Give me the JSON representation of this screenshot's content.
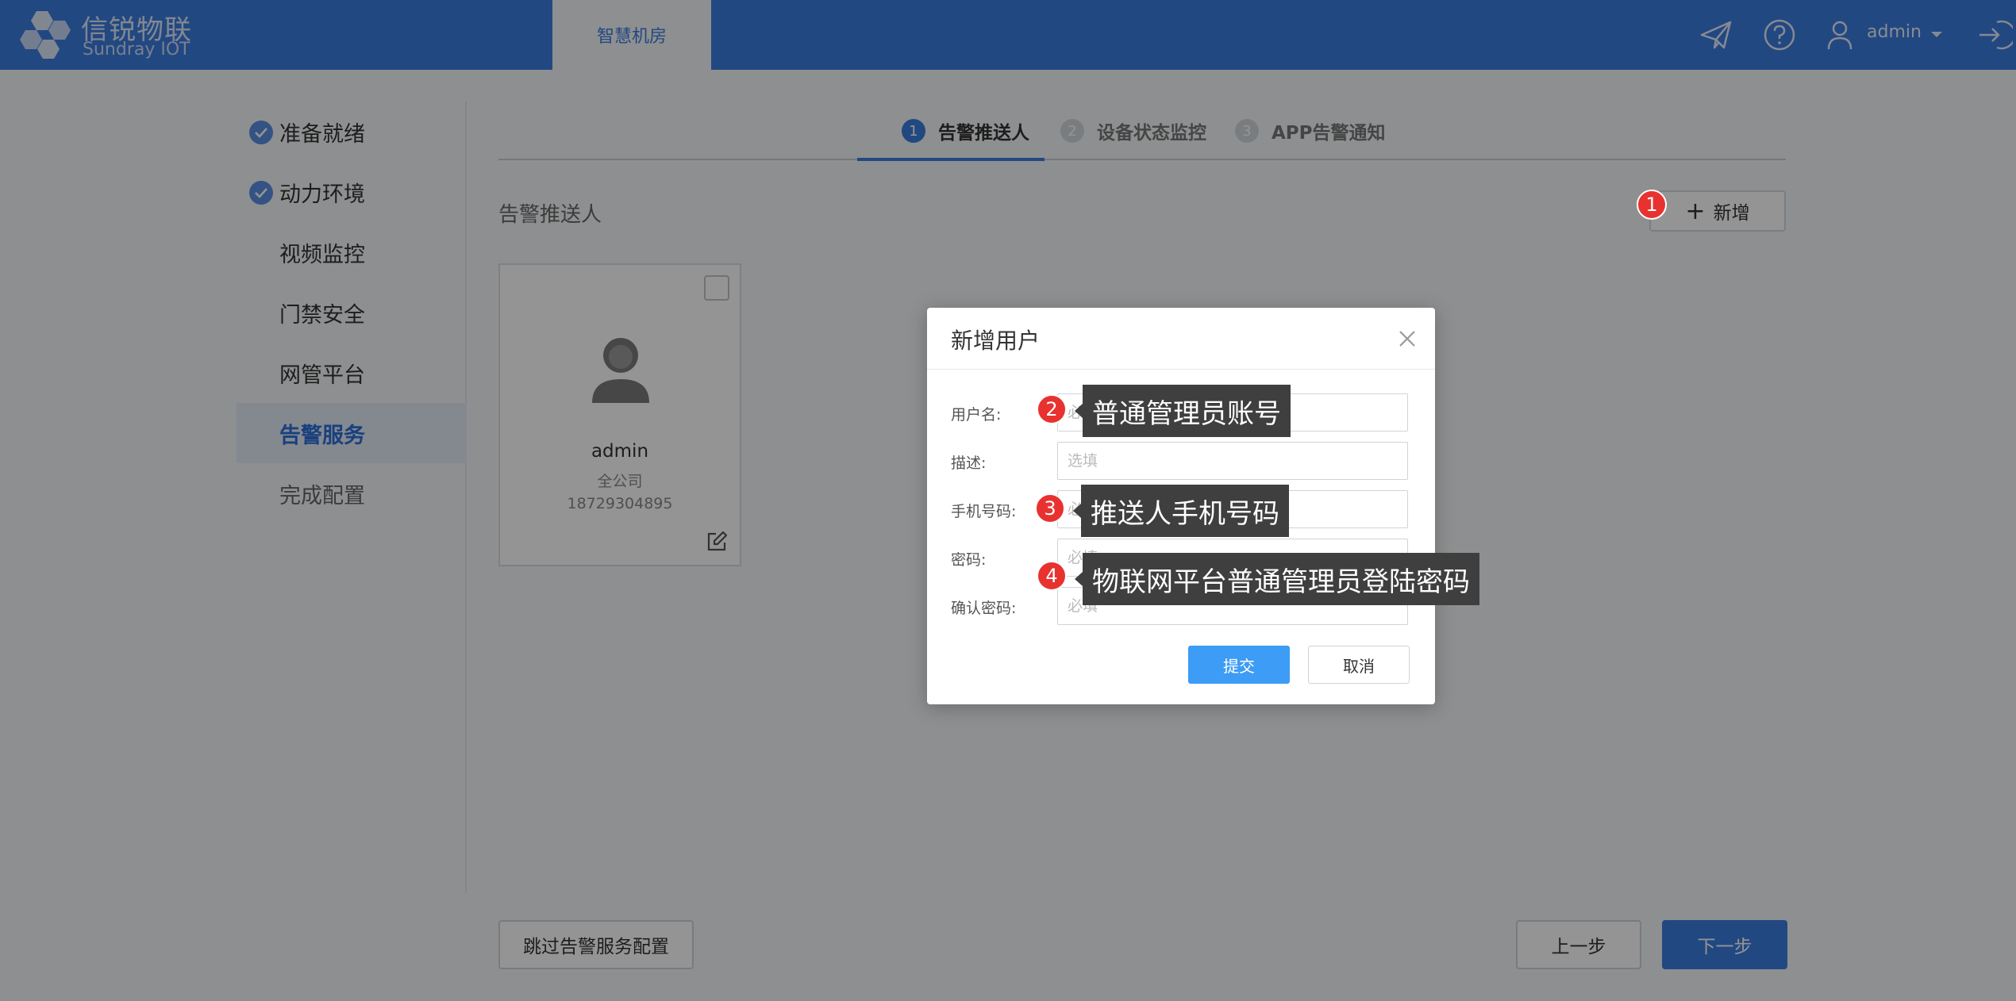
{
  "topbar": {
    "brand_title": "信锐物联",
    "brand_sub": "Sundray IOT",
    "active_tab": "智慧机房",
    "username": "admin"
  },
  "sidebar": {
    "items": [
      {
        "label": "准备就绪",
        "state": "done"
      },
      {
        "label": "动力环境",
        "state": "done"
      },
      {
        "label": "视频监控",
        "state": "normal"
      },
      {
        "label": "门禁安全",
        "state": "normal"
      },
      {
        "label": "网管平台",
        "state": "normal"
      },
      {
        "label": "告警服务",
        "state": "active"
      },
      {
        "label": "完成配置",
        "state": "muted"
      }
    ]
  },
  "steps": [
    {
      "num": "1",
      "label": "告警推送人"
    },
    {
      "num": "2",
      "label": "设备状态监控"
    },
    {
      "num": "3",
      "label": "APP告警通知"
    }
  ],
  "section": {
    "title": "告警推送人",
    "add_label": "新增"
  },
  "card": {
    "name": "admin",
    "dept": "全公司",
    "phone": "18729304895"
  },
  "footer": {
    "skip_label": "跳过告警服务配置",
    "prev_label": "上一步",
    "next_label": "下一步"
  },
  "dialog": {
    "title": "新增用户",
    "fields": [
      {
        "label": "用户名:",
        "placeholder": "必填"
      },
      {
        "label": "描述:",
        "placeholder": "选填"
      },
      {
        "label": "手机号码:",
        "placeholder": "必填"
      },
      {
        "label": "密码:",
        "placeholder": "必填"
      },
      {
        "label": "确认密码:",
        "placeholder": "必填"
      }
    ],
    "submit_label": "提交",
    "cancel_label": "取消"
  },
  "annotations": [
    {
      "num": "1"
    },
    {
      "num": "2",
      "text": "普通管理员账号"
    },
    {
      "num": "3",
      "text": "推送人手机号码"
    },
    {
      "num": "4",
      "text": "物联网平台普通管理员登陆密码"
    }
  ],
  "colors": {
    "brand": "#3c7ce0",
    "submit": "#3d9cf5",
    "marker": "#e8322f"
  }
}
